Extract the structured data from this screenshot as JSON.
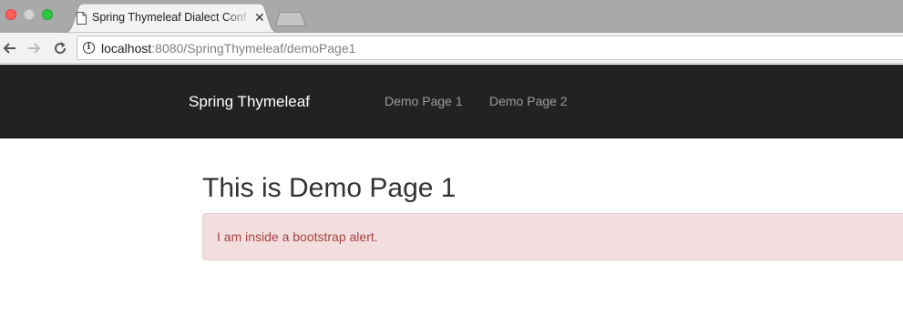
{
  "browser": {
    "tab": {
      "title": "Spring Thymeleaf Dialect Conf",
      "close_glyph": "✕",
      "icon": "page-icon"
    },
    "new_tab_icon": "new-tab-icon",
    "back_icon": "arrow-left-icon",
    "forward_icon": "arrow-right-icon",
    "reload_icon": "reload-icon",
    "omnibox": {
      "info_glyph": "i",
      "url_host": "localhost",
      "url_rest": ":8080/SpringThymeleaf/demoPage1"
    }
  },
  "navbar": {
    "brand": "Spring Thymeleaf",
    "links": [
      {
        "label": "Demo Page 1"
      },
      {
        "label": "Demo Page 2"
      }
    ],
    "background": "#222222",
    "link_color": "#9d9d9d"
  },
  "main": {
    "heading": "This is Demo Page 1",
    "alert": {
      "text": "I am inside a bootstrap alert.",
      "background": "#f2dede",
      "text_color": "#a94442"
    }
  }
}
